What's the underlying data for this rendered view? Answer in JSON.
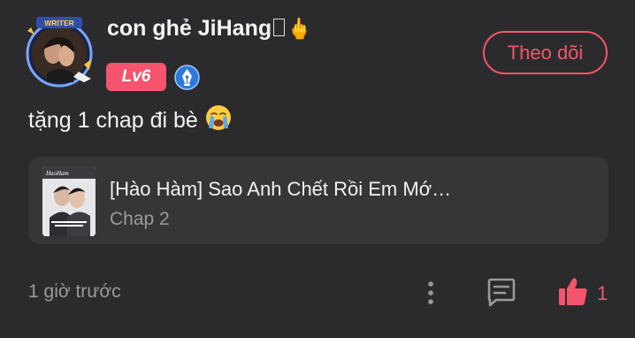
{
  "user": {
    "name": "con ghẻ JiHang",
    "name_suffix_emoji": "🖕",
    "avatar_frame_label": "WRITER",
    "level": "Lv6",
    "verified_icon": "pen-nib-badge-icon"
  },
  "follow_button_label": "Theo dõi",
  "comment": {
    "text": "tặng 1 chap đi bè",
    "emoji": "😭"
  },
  "linked_story": {
    "title": "[Hào Hàm] Sao Anh Chết Rồi Em Mớ…",
    "chapter": "Chap 2",
    "cover_caption": "HaoHam"
  },
  "footer": {
    "time": "1 giờ trước",
    "like_count": "1",
    "icons": [
      "more-vertical-icon",
      "reply-icon",
      "thumbs-up-icon"
    ]
  },
  "colors": {
    "background": "#2b2b2d",
    "card": "#363638",
    "accent": "#f4546d",
    "verified_blue": "#2f7ad9",
    "muted_text": "#9a9a9c"
  }
}
